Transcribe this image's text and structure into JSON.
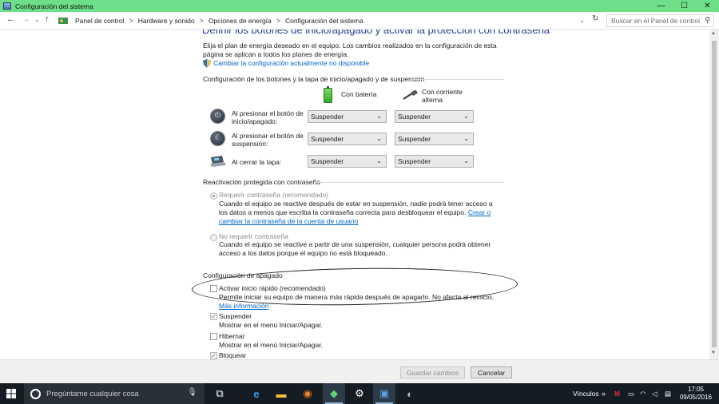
{
  "window": {
    "title": "Configuración del sistema",
    "minimize": "—",
    "maximize": "☐",
    "close": "✕"
  },
  "address": {
    "back": "←",
    "forward": "→",
    "up": "↑",
    "crumbs": [
      "Panel de control",
      "Hardware y sonido",
      "Opciones de energía",
      "Configuración del sistema"
    ],
    "separator": ">",
    "refresh": "↻",
    "search_placeholder": "Buscar en el Panel de control"
  },
  "page": {
    "heading": "Definir los botones de inicio/apagado y activar la protección con contraseña",
    "intro": "Elija el plan de energía deseado en el equipo. Los cambios realizados en la configuración de esta página se aplican a todos los planes de energía.",
    "change_link": "Cambiar la configuración actualmente no disponible"
  },
  "buttons_section": {
    "title": "Configuración de los botones y la tapa de inicio/apagado y de suspensión",
    "col_battery": "Con batería",
    "col_ac_line1": "Con corriente",
    "col_ac_line2": "alterna",
    "rows": [
      {
        "label1": "Al presionar el botón de",
        "label2": "inicio/apagado:",
        "battery": "Suspender",
        "ac": "Suspender"
      },
      {
        "label1": "Al presionar el botón de",
        "label2": "suspensión:",
        "battery": "Suspender",
        "ac": "Suspender"
      },
      {
        "label1": "Al cerrar la tapa:",
        "label2": "",
        "battery": "Suspender",
        "ac": "Suspender"
      }
    ]
  },
  "password_section": {
    "title": "Reactivación protegida con contraseña",
    "require_label": "Requerir contraseña (recomendado)",
    "require_desc": "Cuando el equipo se reactive después de estar en suspensión, nadie podrá tener acceso a los datos a menos que escriba la contraseña correcta para desbloquear el equipo.",
    "require_link": "Crear o cambiar la contraseña de la cuenta de usuario",
    "norequire_label": "No requerir contraseña",
    "norequire_desc": "Cuando el equipo se reactive a partir de una suspensión, cualquier persona podrá obtener acceso a los datos porque el equipo no está bloqueado."
  },
  "shutdown_section": {
    "title": "Configuración de apagado",
    "fast_label": "Activar inicio rápido (recomendado)",
    "fast_desc": "Permite iniciar su equipo de manera más rápida después de apagarlo. No afecta al reinicio.",
    "fast_link": "Más información",
    "suspend_label": "Suspender",
    "suspend_desc": "Mostrar en el menú Iniciar/Apagar.",
    "hibernate_label": "Hibernar",
    "hibernate_desc": "Mostrar en el menú Iniciar/Apagar.",
    "lock_label": "Bloquear",
    "check_mark": "✓"
  },
  "footer": {
    "save": "Guardar cambios",
    "cancel": "Cancelar"
  },
  "taskbar": {
    "search_placeholder": "Pregúntame cualquier cosa",
    "links_label": "Vínculos",
    "time": "17:05",
    "date": "09/05/2016",
    "chevron": "»"
  },
  "colors": {
    "titlebar": "#6ede88",
    "link": "#0066cc",
    "heading": "#1f3d8f",
    "taskbar": "#151c24"
  }
}
